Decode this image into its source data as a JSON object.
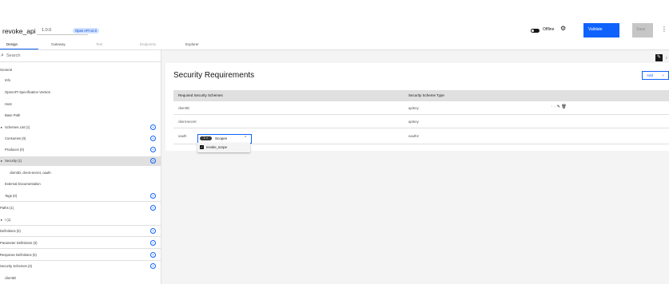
{
  "header": {
    "title": "revoke_api",
    "version": "1.0.0",
    "spec_tag": "Open API v2.0",
    "offline_label": "Offline",
    "validate_label": "Validate",
    "save_label": "Save"
  },
  "tabs": [
    {
      "label": "Design",
      "state": "active"
    },
    {
      "label": "Gateway",
      "state": "normal"
    },
    {
      "label": "Test",
      "state": "disabled"
    },
    {
      "label": "Endpoints",
      "state": "disabled"
    },
    {
      "label": "Explorer",
      "state": "normal"
    }
  ],
  "sidebar": {
    "search_placeholder": "Search",
    "items": [
      {
        "label": "General"
      },
      {
        "label": "Info"
      },
      {
        "label": "OpenAPI Specification Version"
      },
      {
        "label": "Host"
      },
      {
        "label": "Base Path"
      },
      {
        "label": "Schemes List (1)"
      },
      {
        "label": "Consumes (0)"
      },
      {
        "label": "Produces (0)"
      },
      {
        "label": "Security (1)"
      },
      {
        "label": "clientID, client-secret, oauth"
      },
      {
        "label": "External Documentation"
      },
      {
        "label": "Tags (0)"
      },
      {
        "label": "Paths (1)"
      },
      {
        "label": "/ (1)"
      },
      {
        "label": "Definitions (0)"
      },
      {
        "label": "Parameter Definitions (0)"
      },
      {
        "label": "Response Definitions (0)"
      },
      {
        "label": "Security Schemes (3)"
      },
      {
        "label": "clientID"
      }
    ]
  },
  "main": {
    "section_title": "Security Requirements",
    "add_label": "Add",
    "columns": [
      "Required Security Schemes",
      "Security Scheme Type"
    ],
    "rows": [
      {
        "scheme": "clientID",
        "type": "apiKey"
      },
      {
        "scheme": "client-secret",
        "type": "apiKey"
      },
      {
        "scheme": "oauth",
        "type": "oauth2"
      }
    ],
    "scopes": {
      "count": "1",
      "label": "Scopes",
      "options": [
        {
          "label": "revoke_scope",
          "checked": true
        }
      ]
    }
  },
  "colors": {
    "accent": "#0f62fe",
    "selected_row": "#e0e0e0",
    "main_bg": "#f4f4f4"
  }
}
